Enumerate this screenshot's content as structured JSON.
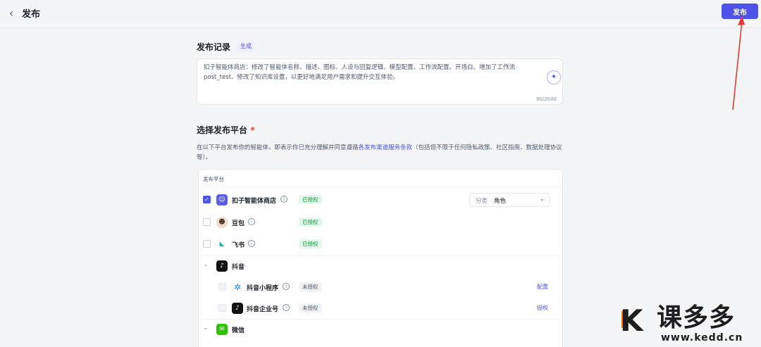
{
  "header": {
    "back_icon": "chevron-left-icon",
    "title": "发布",
    "publish_label": "发布"
  },
  "record": {
    "title": "发布记录",
    "generate_label": "生成",
    "text": "扣子智能体商店：修改了智能体名称、描述、图标、人设与回复逻辑、模型配置、工作流配置、开场白、增加了工作流post_test、修改了知识库设置，以更好地满足用户需求和提升交互体验。",
    "counter": "90/2000",
    "magic_icon": "magic-wand-icon"
  },
  "platforms": {
    "title": "选择发布平台",
    "required_mark": "*",
    "desc_prefix": "在以下平台发布你的智能体，即表示你已充分理解并同意遵循",
    "desc_link": "各发布渠道服务条款",
    "desc_suffix": "（包括但不限于任何隐私政策、社区指南、数据处理协议等）。",
    "table_header": "发布平台",
    "category": {
      "label": "分类",
      "value": "角色"
    },
    "items": [
      {
        "name": "扣子智能体商店",
        "status": "已授权",
        "checked": true
      },
      {
        "name": "豆包",
        "status": "已授权",
        "checked": false
      },
      {
        "name": "飞书",
        "status": "已授权",
        "checked": false
      }
    ],
    "groups": [
      {
        "name": "抖音",
        "children": [
          {
            "name": "抖音小程序",
            "status": "未授权",
            "action": "配置"
          },
          {
            "name": "抖音企业号",
            "status": "未授权",
            "action": "授权"
          }
        ]
      },
      {
        "name": "微信"
      }
    ]
  },
  "watermark": {
    "letter": "K",
    "text": "课多多",
    "url": "www.kedd.cn"
  },
  "colors": {
    "accent": "#4d53e8",
    "authorized_bg": "#e8f7ee",
    "authorized_text": "#00a136",
    "arrow": "#e53935"
  }
}
